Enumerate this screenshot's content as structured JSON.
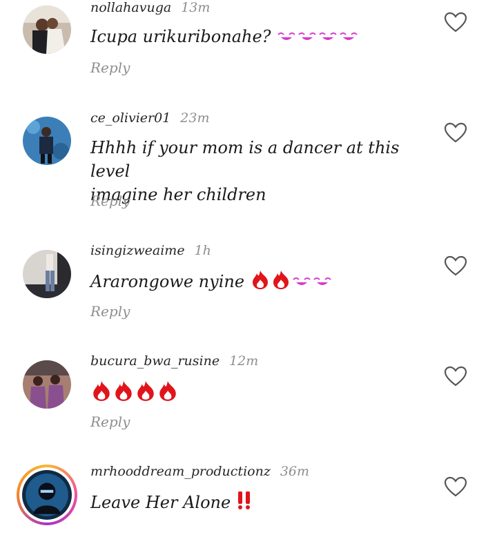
{
  "comments": [
    {
      "username": "nollahavuga",
      "time": "13m",
      "text": "Icupa urikuribonahe?",
      "reply": "Reply"
    },
    {
      "username": "ce_olivier01",
      "time": "23m",
      "text_line1": "Hhhh if your mom is a dancer at this level",
      "text_line2": "imagine her children",
      "reply": "Reply"
    },
    {
      "username": "isingizweaime",
      "time": "1h",
      "text": "Ararongowe nyine",
      "reply": "Reply"
    },
    {
      "username": "bucura_bwa_rusine",
      "time": "12m",
      "text": "",
      "reply": "Reply"
    },
    {
      "username": "mrhooddream_productionz",
      "time": "36m",
      "text": "Leave Her Alone",
      "reply": ""
    }
  ],
  "icons": {
    "like": "heart-outline-icon",
    "fire": "fire-emoji",
    "laugh": "laughing-emoji",
    "alert": "double-exclamation-emoji"
  },
  "colors": {
    "username": "#262626",
    "time": "#8e8e8e",
    "fire": "#e0151b",
    "laugh": "#d63ad0",
    "story_ring": "#f0509a"
  }
}
